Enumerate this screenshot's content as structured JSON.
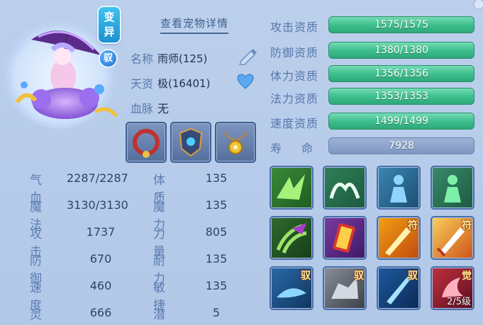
{
  "pet": {
    "mutation_tag": "变异",
    "ride_tag": "驭",
    "detail_link": "查看宠物详情",
    "name_label": "名称",
    "name_value": "雨师(125)",
    "talent_label": "天资",
    "talent_value": "极(16401)",
    "bloodline_label": "血脉",
    "bloodline_value": "无"
  },
  "equipment": [
    {
      "icon": "collar-icon"
    },
    {
      "icon": "armor-icon"
    },
    {
      "icon": "amulet-icon"
    }
  ],
  "stats": [
    {
      "label": "气血",
      "value": "2287/2287",
      "label2": "体质",
      "value2": "135"
    },
    {
      "label": "魔法",
      "value": "3130/3130",
      "label2": "魔力",
      "value2": "135"
    },
    {
      "label": "攻击",
      "value": "1737",
      "label2": "力量",
      "value2": "805"
    },
    {
      "label": "防御",
      "value": "670",
      "label2": "耐力",
      "value2": "135"
    },
    {
      "label": "速度",
      "value": "460",
      "label2": "敏捷",
      "value2": "135"
    },
    {
      "label": "灵力",
      "value": "666",
      "label2": "潜力",
      "value2": "5"
    }
  ],
  "aptitudes": [
    {
      "label": "攻击资质",
      "value": "1575/1575",
      "fill": 1.0
    },
    {
      "label": "防御资质",
      "value": "1380/1380",
      "fill": 1.0
    },
    {
      "label": "体力资质",
      "value": "1356/1356",
      "fill": 1.0
    },
    {
      "label": "法力资质",
      "value": "1353/1353",
      "fill": 1.0
    },
    {
      "label": "速度资质",
      "value": "1499/1499",
      "fill": 1.0
    },
    {
      "label": "寿　命",
      "value": "7928"
    }
  ],
  "skills": [
    {
      "icon": "green-strike-skill-icon",
      "badge": ""
    },
    {
      "icon": "wings-skill-icon",
      "badge": ""
    },
    {
      "icon": "blue-figure-skill-icon",
      "badge": ""
    },
    {
      "icon": "green-figure-skill-icon",
      "badge": ""
    },
    {
      "icon": "claw-skill-icon",
      "badge": ""
    },
    {
      "icon": "red-book-skill-icon",
      "badge": ""
    },
    {
      "icon": "flame-talisman-skill-icon",
      "badge": "符"
    },
    {
      "icon": "sword-talisman-skill-icon",
      "badge": "符"
    },
    {
      "icon": "blue-rider-skill-icon",
      "badge": "驭"
    },
    {
      "icon": "stone-rider-skill-icon",
      "badge": "驭"
    },
    {
      "icon": "blade-rider-skill-icon",
      "badge": "驭"
    },
    {
      "icon": "awaken-skill-icon",
      "badge": "觉",
      "level": "2/5级"
    }
  ],
  "colors": {
    "bar_green": "#3fbf8e",
    "bar_blue": "#7f97c2",
    "background": "#b8cdea"
  }
}
